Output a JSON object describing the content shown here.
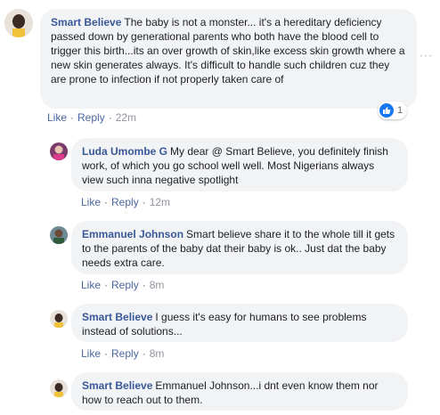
{
  "comments": [
    {
      "author": "Smart Believe",
      "text": "The baby is not a monster... it's a hereditary deficiency passed down by generational parents who both have the blood cell to trigger this birth...its an over growth of skin,like excess skin growth where a new skin generates always. It's difficult to handle such children cuz they are prone to infection if not properly taken care of",
      "like_label": "Like",
      "reply_label": "Reply",
      "time": "22m",
      "reaction_count": "1"
    },
    {
      "author": "Luda Umombe G",
      "text": "My dear @ Smart Believe, you definitely finish work, of which you go school well well. Most Nigerians always view such inna negative spotlight",
      "like_label": "Like",
      "reply_label": "Reply",
      "time": "12m"
    },
    {
      "author": "Emmanuel Johnson",
      "text": "Smart believe share it to the whole till it gets to the parents of the baby dat their baby is ok.. Just dat the baby needs extra care.",
      "like_label": "Like",
      "reply_label": "Reply",
      "time": "8m"
    },
    {
      "author": "Smart Believe",
      "text": "I guess it's easy for humans to see problems instead of solutions...",
      "like_label": "Like",
      "reply_label": "Reply",
      "time": "8m"
    },
    {
      "author": "Smart Believe",
      "text": "Emmanuel Johnson...i dnt even know them nor how to reach out to them."
    }
  ],
  "icons": {
    "reaction": "like-icon",
    "more": "more-options-icon",
    "colors": {
      "link": "#385898",
      "bubble": "#f2f3f5",
      "like_blue": "#1877f2"
    }
  }
}
